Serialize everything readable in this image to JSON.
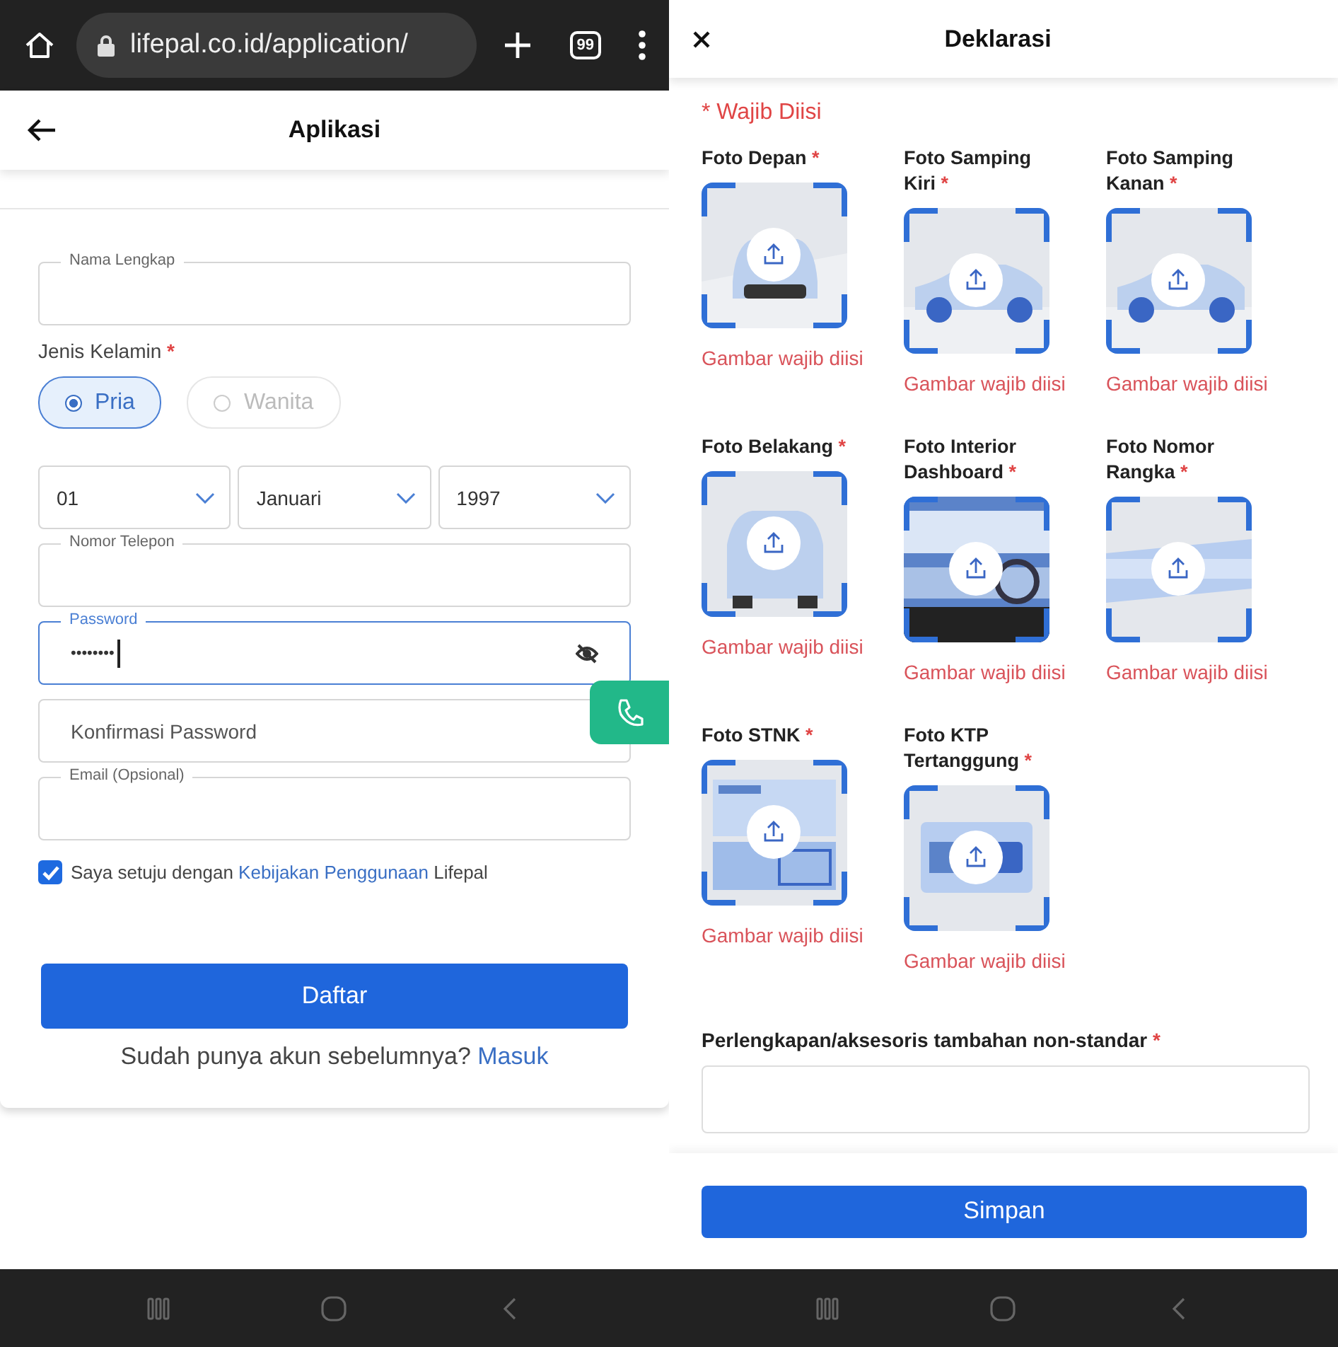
{
  "left": {
    "browser": {
      "url": "lifepal.co.id/application/",
      "tab_count": "99"
    },
    "header": {
      "title": "Aplikasi"
    },
    "name_field": {
      "label": "Nama Lengkap"
    },
    "gender": {
      "label": "Jenis Kelamin",
      "required_mark": "*",
      "options": [
        {
          "label": "Pria",
          "selected": true
        },
        {
          "label": "Wanita",
          "selected": false
        }
      ]
    },
    "birthdate": [
      "01",
      "Januari",
      "1997"
    ],
    "fields": [
      {
        "kind": "outlined",
        "label": "Nomor Telepon",
        "focused": false
      },
      {
        "kind": "password",
        "label": "Password",
        "value": "••••••••",
        "focused": true
      },
      {
        "kind": "placeholder",
        "placeholder": "Konfirmasi Password",
        "focused": false
      },
      {
        "kind": "outlined",
        "label": "Email (Opsional)",
        "focused": false
      }
    ],
    "agreement": {
      "checked": true,
      "before": "Saya setuju dengan",
      "link": "Kebijakan Penggunaan",
      "after": "Lifepal"
    },
    "submit": "Daftar",
    "login": {
      "text": "Sudah punya akun sebelumnya?",
      "link": "Masuk"
    }
  },
  "right": {
    "header": {
      "title": "Deklarasi"
    },
    "required_note": "* Wajib Diisi",
    "photos": [
      {
        "kind": "front",
        "label": "Foto Depan",
        "required_mark": "*",
        "error": "Gambar wajib diisi"
      },
      {
        "kind": "side",
        "label": "Foto Samping Kiri",
        "required_mark": "*",
        "error": "Gambar wajib diisi"
      },
      {
        "kind": "side",
        "label": "Foto Samping Kanan",
        "required_mark": "*",
        "error": "Gambar wajib diisi"
      },
      {
        "kind": "rear",
        "label": "Foto Belakang",
        "required_mark": "*",
        "error": "Gambar wajib diisi"
      },
      {
        "kind": "interior",
        "label": "Foto Interior Dashboard",
        "required_mark": "*",
        "error": "Gambar wajib diisi"
      },
      {
        "kind": "frame",
        "label": "Foto Nomor Rangka",
        "required_mark": "*",
        "error": "Gambar wajib diisi"
      },
      {
        "kind": "document",
        "label": "Foto STNK",
        "required_mark": "*",
        "error": "Gambar wajib diisi"
      },
      {
        "kind": "card",
        "label": "Foto KTP Tertanggung",
        "required_mark": "*",
        "error": "Gambar wajib diisi"
      }
    ],
    "accessories": {
      "label": "Perlengkapan/aksesoris tambahan non-standar",
      "required_mark": "*"
    },
    "save": "Simpan"
  }
}
